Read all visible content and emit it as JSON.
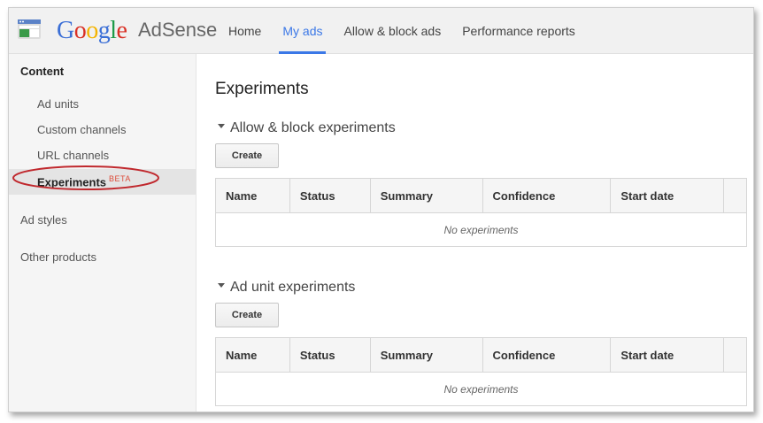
{
  "header": {
    "logo_brand": "Google",
    "logo_product": "AdSense",
    "nav": [
      {
        "label": "Home",
        "active": false
      },
      {
        "label": "My ads",
        "active": true
      },
      {
        "label": "Allow & block ads",
        "active": false
      },
      {
        "label": "Performance reports",
        "active": false
      }
    ],
    "accent_color": "#3b78e7"
  },
  "sidebar": {
    "heading": "Content",
    "sub_items": [
      "Ad units",
      "Custom channels",
      "URL channels"
    ],
    "selected": {
      "label": "Experiments",
      "badge": "BETA"
    },
    "top_items": [
      "Ad styles",
      "Other products"
    ],
    "highlight_color": "#c0282d"
  },
  "main": {
    "title": "Experiments",
    "sections": [
      {
        "title": "Allow & block experiments",
        "button": "Create",
        "columns": [
          "Name",
          "Status",
          "Summary",
          "Confidence",
          "Start date",
          ""
        ],
        "empty_text": "No experiments"
      },
      {
        "title": "Ad unit experiments",
        "button": "Create",
        "columns": [
          "Name",
          "Status",
          "Summary",
          "Confidence",
          "Start date",
          ""
        ],
        "empty_text": "No experiments"
      }
    ]
  },
  "icons": {
    "app": "adsense-app-icon",
    "section_toggle": "triangle-down-icon"
  }
}
